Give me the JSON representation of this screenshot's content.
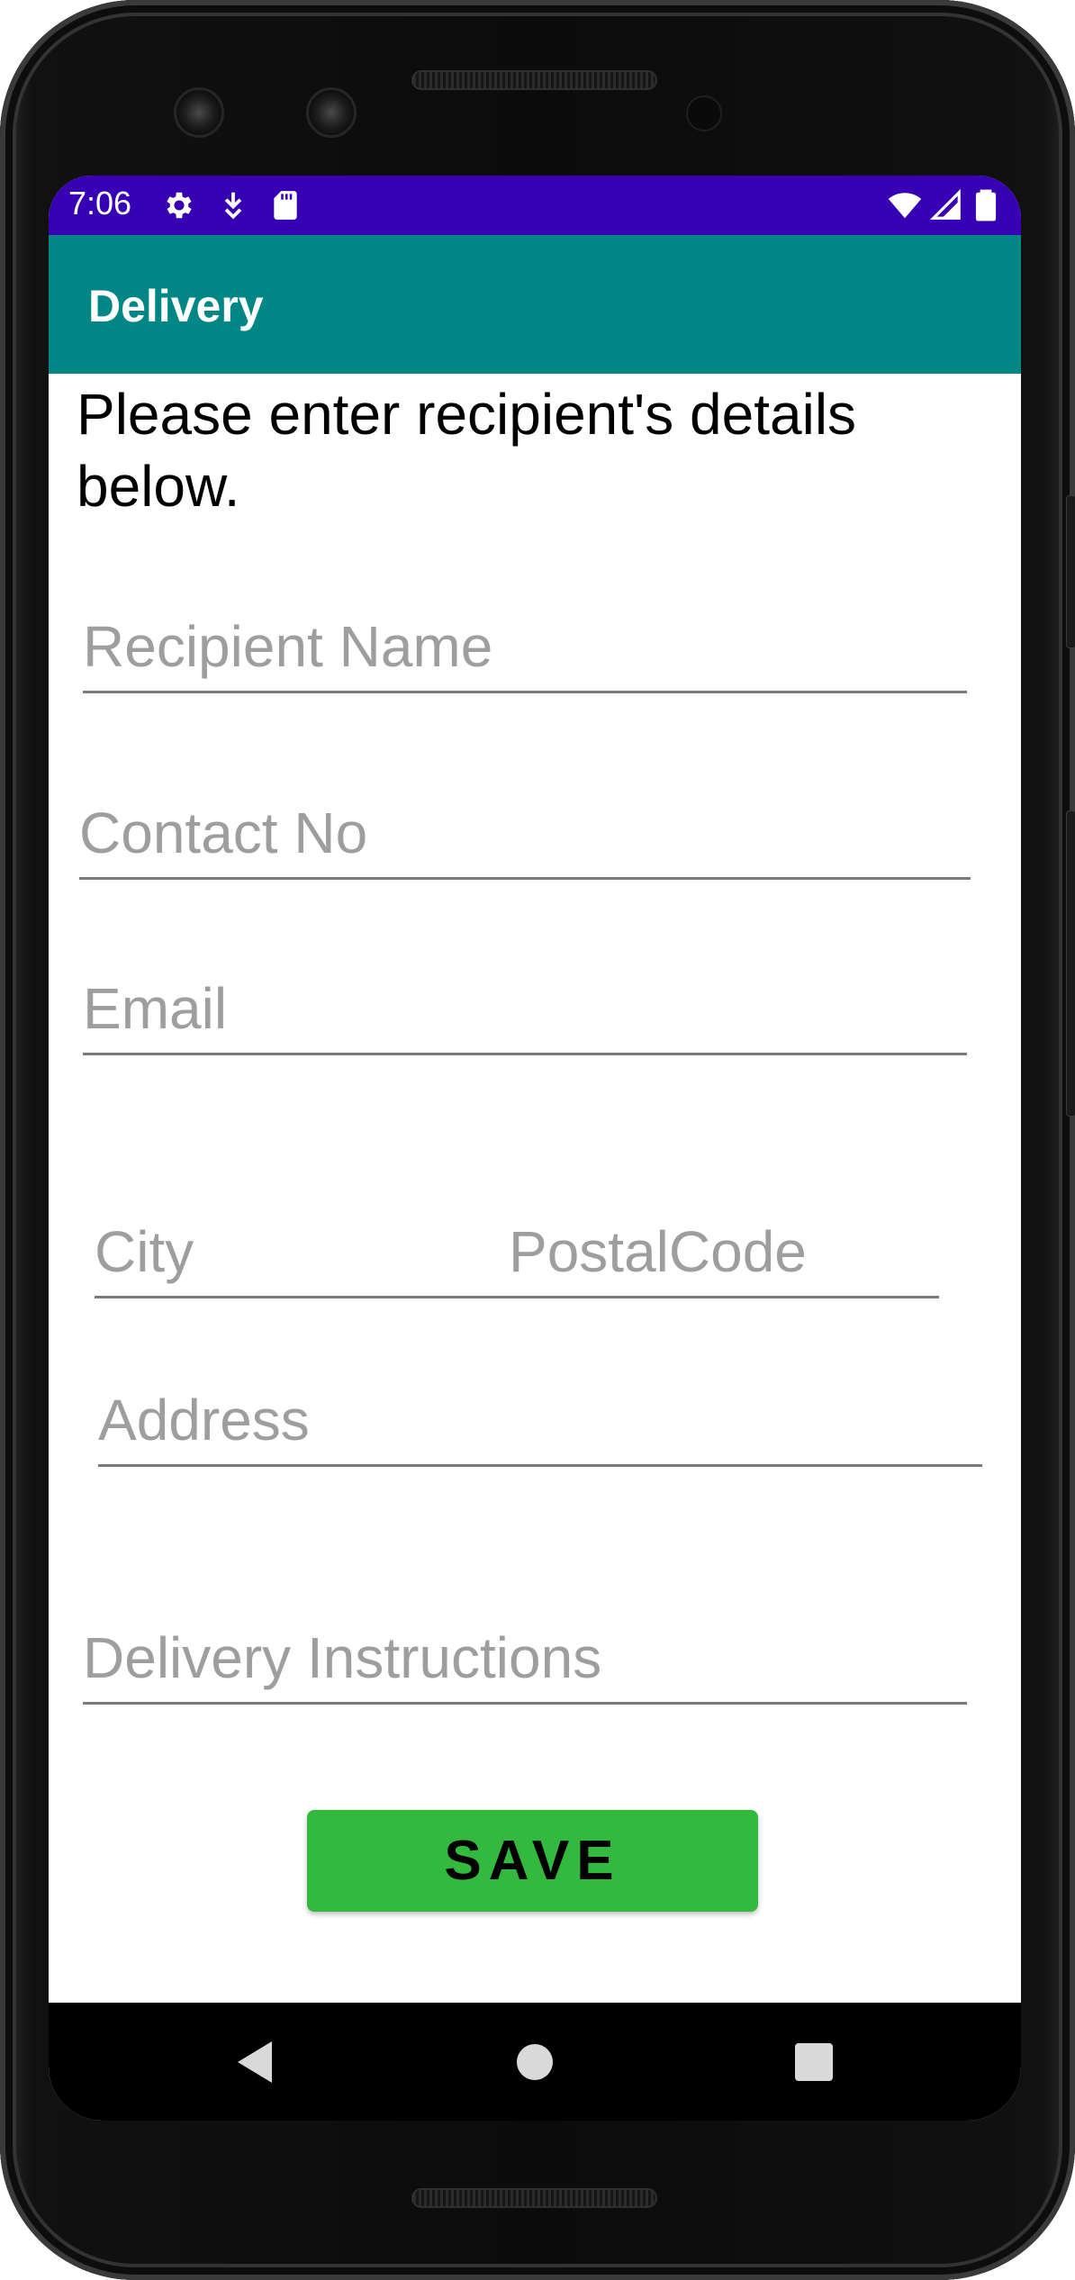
{
  "status_bar": {
    "time": "7:06",
    "left_icons": [
      "gear-icon",
      "download-arrow-icon",
      "sd-card-icon"
    ],
    "right_icons": [
      "wifi-icon",
      "signal-icon",
      "battery-icon"
    ],
    "color": "#3700b3"
  },
  "app_bar": {
    "title": "Delivery",
    "color": "#008785"
  },
  "form": {
    "instructions": "Please enter recipient's details below.",
    "recipient_name_placeholder": "Recipient Name",
    "contact_no_placeholder": "Contact No",
    "email_placeholder": "Email",
    "city_placeholder": "City",
    "postal_code_placeholder": "PostalCode",
    "address_placeholder": "Address",
    "delivery_instructions_placeholder": "Delivery Instructions",
    "save_label": "SAVE",
    "save_color": "#34b93f"
  },
  "nav_bar": {
    "icons": [
      "back-icon",
      "home-icon",
      "recents-icon"
    ]
  }
}
